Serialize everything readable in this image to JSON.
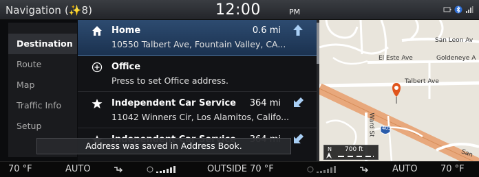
{
  "header": {
    "title": "Navigation",
    "count": "(✨8)",
    "clock": "12:00",
    "clock_period": "PM"
  },
  "menu": {
    "items": [
      {
        "label": "Destination",
        "active": true
      },
      {
        "label": "Route",
        "active": false
      },
      {
        "label": "Map",
        "active": false
      },
      {
        "label": "Traffic Info",
        "active": false
      },
      {
        "label": "Setup",
        "active": false
      }
    ]
  },
  "list": {
    "rows": [
      {
        "icon": "home-icon",
        "name": "Home",
        "address": "10550 Talbert Ave, Fountain Valley, CA...",
        "distance": "0.6 mi",
        "direction": "north-arrow-icon"
      },
      {
        "icon": "plus-circle-icon",
        "name": "Office",
        "address": "Press to set Office address.",
        "distance": "",
        "direction": ""
      },
      {
        "icon": "star-icon",
        "name": "Independent Car Service",
        "address": "11042 Winners Cir, Los Alamitos, Califo...",
        "distance": "364 mi",
        "direction": "southwest-arrow-icon"
      },
      {
        "icon": "star-icon",
        "name": "Independent Car Service",
        "address": "",
        "distance": "364 mi",
        "direction": "northwest-arrow-icon"
      }
    ]
  },
  "map": {
    "labels": {
      "san_leon": "San Leon Av",
      "el_este": "El Este Ave",
      "goldeneye": "Goldeneye A",
      "talbert": "Talbert Ave",
      "ward": "Ward St",
      "shield": "405",
      "san": "San",
      "scale": "700 ft",
      "compass": "N"
    }
  },
  "toast": {
    "message": "Address was saved in Address Book."
  },
  "climate": {
    "left_temp": "70 °F",
    "left_mode": "AUTO",
    "outside": "OUTSIDE 70 °F",
    "right_mode": "AUTO",
    "right_temp": "70 °F"
  },
  "colors": {
    "selected_row": "#2d4b70",
    "pin": "#e0541b",
    "highway": "#e8a87c",
    "accent_arrow": "#6aa9e8"
  }
}
